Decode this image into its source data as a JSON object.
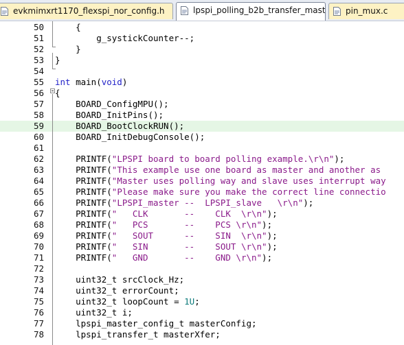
{
  "tabs": [
    {
      "label": "evkmimxrt1170_flexspi_nor_config.h",
      "active": false
    },
    {
      "label": "lpspi_polling_b2b_transfer_master.c",
      "active": true
    },
    {
      "label": "pin_mux.c",
      "active": false
    }
  ],
  "current_line": 59,
  "lines": [
    {
      "n": "50",
      "t": "    {"
    },
    {
      "n": "51",
      "t": "        g_systickCounter--;"
    },
    {
      "n": "52",
      "t": "    }"
    },
    {
      "n": "53",
      "t": "}"
    },
    {
      "n": "54",
      "t": ""
    },
    {
      "n": "55",
      "a": "int",
      "b": " main(",
      "c": "void",
      "d": ")"
    },
    {
      "n": "56",
      "t": "{"
    },
    {
      "n": "57",
      "t": "    BOARD_ConfigMPU();"
    },
    {
      "n": "58",
      "t": "    BOARD_InitPins();"
    },
    {
      "n": "59",
      "t": "    BOARD_BootClockRUN();"
    },
    {
      "n": "60",
      "t": "    BOARD_InitDebugConsole();"
    },
    {
      "n": "61",
      "t": ""
    },
    {
      "n": "62",
      "a": "    PRINTF(",
      "b": "\"LPSPI board to board polling example.\\r\\n\"",
      "c": ");"
    },
    {
      "n": "63",
      "a": "    PRINTF(",
      "b": "\"This example use one board as master and another as",
      "c": ""
    },
    {
      "n": "64",
      "a": "    PRINTF(",
      "b": "\"Master uses polling way and slave uses interrupt way",
      "c": ""
    },
    {
      "n": "65",
      "a": "    PRINTF(",
      "b": "\"Please make sure you make the correct line connectio",
      "c": ""
    },
    {
      "n": "66",
      "a": "    PRINTF(",
      "b": "\"LPSPI_master --  LPSPI_slave   \\r\\n\"",
      "c": ");"
    },
    {
      "n": "67",
      "a": "    PRINTF(",
      "b": "\"   CLK       --    CLK  \\r\\n\"",
      "c": ");"
    },
    {
      "n": "68",
      "a": "    PRINTF(",
      "b": "\"   PCS       --    PCS \\r\\n\"",
      "c": ");"
    },
    {
      "n": "69",
      "a": "    PRINTF(",
      "b": "\"   SOUT      --    SIN  \\r\\n\"",
      "c": ");"
    },
    {
      "n": "70",
      "a": "    PRINTF(",
      "b": "\"   SIN       --    SOUT \\r\\n\"",
      "c": ");"
    },
    {
      "n": "71",
      "a": "    PRINTF(",
      "b": "\"   GND       --    GND \\r\\n\"",
      "c": ");"
    },
    {
      "n": "72",
      "t": ""
    },
    {
      "n": "73",
      "t": "    uint32_t srcClock_Hz;"
    },
    {
      "n": "74",
      "t": "    uint32_t errorCount;"
    },
    {
      "n": "75",
      "a": "    uint32_t loopCount = ",
      "b": "1U",
      "c": ";"
    },
    {
      "n": "76",
      "t": "    uint32_t i;"
    },
    {
      "n": "77",
      "t": "    lpspi_master_config_t masterConfig;"
    },
    {
      "n": "78",
      "t": "    lpspi_transfer_t masterXfer;"
    }
  ],
  "colors": {
    "keyword": "#1f1fc8",
    "string": "#8a1a8a",
    "number": "#0a7a7a",
    "current_line_bg": "#e5f6e5",
    "tab_inactive": "#fdf2c4"
  }
}
